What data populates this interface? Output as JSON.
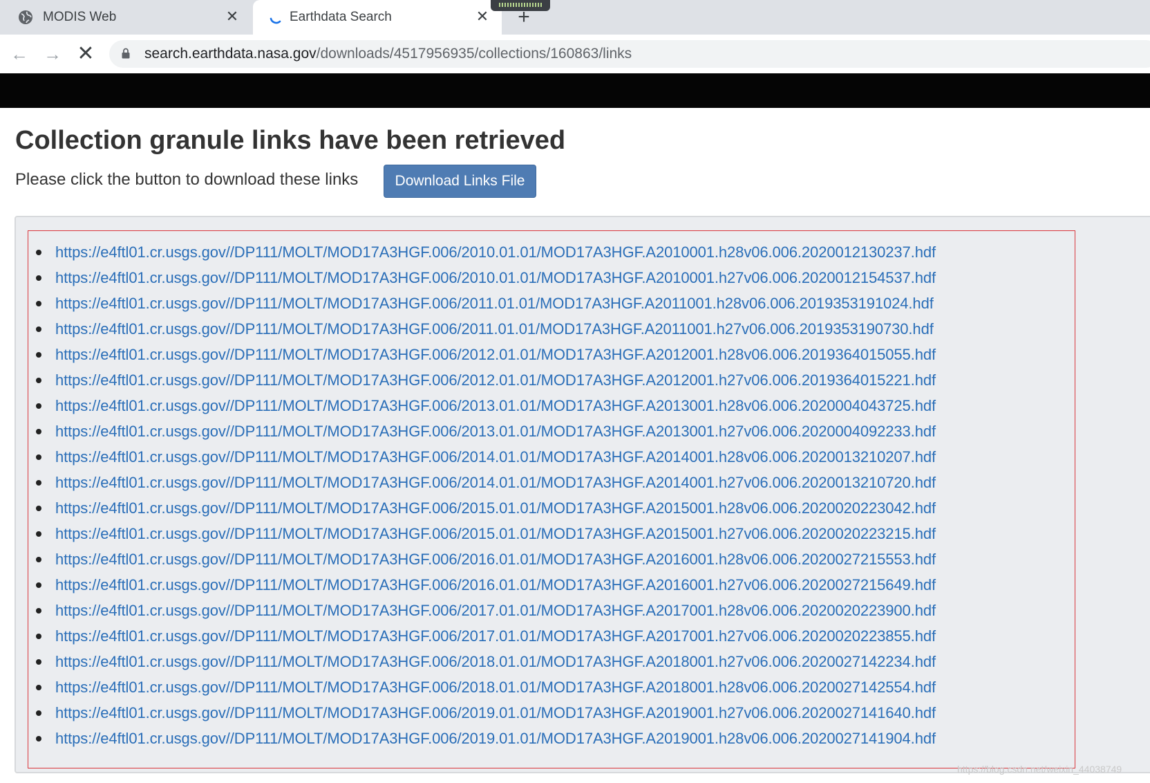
{
  "browser": {
    "tabs": [
      {
        "title": "MODIS Web",
        "active": false
      },
      {
        "title": "Earthdata Search",
        "active": true
      }
    ],
    "address": {
      "host": "search.earthdata.nasa.gov",
      "path": "/downloads/4517956935/collections/160863/links"
    }
  },
  "page": {
    "title": "Collection granule links have been retrieved",
    "instructions": "Please click the button to download these links",
    "download_button": "Download Links File",
    "links": [
      "https://e4ftl01.cr.usgs.gov//DP111/MOLT/MOD17A3HGF.006/2010.01.01/MOD17A3HGF.A2010001.h28v06.006.2020012130237.hdf",
      "https://e4ftl01.cr.usgs.gov//DP111/MOLT/MOD17A3HGF.006/2010.01.01/MOD17A3HGF.A2010001.h27v06.006.2020012154537.hdf",
      "https://e4ftl01.cr.usgs.gov//DP111/MOLT/MOD17A3HGF.006/2011.01.01/MOD17A3HGF.A2011001.h28v06.006.2019353191024.hdf",
      "https://e4ftl01.cr.usgs.gov//DP111/MOLT/MOD17A3HGF.006/2011.01.01/MOD17A3HGF.A2011001.h27v06.006.2019353190730.hdf",
      "https://e4ftl01.cr.usgs.gov//DP111/MOLT/MOD17A3HGF.006/2012.01.01/MOD17A3HGF.A2012001.h28v06.006.2019364015055.hdf",
      "https://e4ftl01.cr.usgs.gov//DP111/MOLT/MOD17A3HGF.006/2012.01.01/MOD17A3HGF.A2012001.h27v06.006.2019364015221.hdf",
      "https://e4ftl01.cr.usgs.gov//DP111/MOLT/MOD17A3HGF.006/2013.01.01/MOD17A3HGF.A2013001.h28v06.006.2020004043725.hdf",
      "https://e4ftl01.cr.usgs.gov//DP111/MOLT/MOD17A3HGF.006/2013.01.01/MOD17A3HGF.A2013001.h27v06.006.2020004092233.hdf",
      "https://e4ftl01.cr.usgs.gov//DP111/MOLT/MOD17A3HGF.006/2014.01.01/MOD17A3HGF.A2014001.h28v06.006.2020013210207.hdf",
      "https://e4ftl01.cr.usgs.gov//DP111/MOLT/MOD17A3HGF.006/2014.01.01/MOD17A3HGF.A2014001.h27v06.006.2020013210720.hdf",
      "https://e4ftl01.cr.usgs.gov//DP111/MOLT/MOD17A3HGF.006/2015.01.01/MOD17A3HGF.A2015001.h28v06.006.2020020223042.hdf",
      "https://e4ftl01.cr.usgs.gov//DP111/MOLT/MOD17A3HGF.006/2015.01.01/MOD17A3HGF.A2015001.h27v06.006.2020020223215.hdf",
      "https://e4ftl01.cr.usgs.gov//DP111/MOLT/MOD17A3HGF.006/2016.01.01/MOD17A3HGF.A2016001.h28v06.006.2020027215553.hdf",
      "https://e4ftl01.cr.usgs.gov//DP111/MOLT/MOD17A3HGF.006/2016.01.01/MOD17A3HGF.A2016001.h27v06.006.2020027215649.hdf",
      "https://e4ftl01.cr.usgs.gov//DP111/MOLT/MOD17A3HGF.006/2017.01.01/MOD17A3HGF.A2017001.h28v06.006.2020020223900.hdf",
      "https://e4ftl01.cr.usgs.gov//DP111/MOLT/MOD17A3HGF.006/2017.01.01/MOD17A3HGF.A2017001.h27v06.006.2020020223855.hdf",
      "https://e4ftl01.cr.usgs.gov//DP111/MOLT/MOD17A3HGF.006/2018.01.01/MOD17A3HGF.A2018001.h27v06.006.2020027142234.hdf",
      "https://e4ftl01.cr.usgs.gov//DP111/MOLT/MOD17A3HGF.006/2018.01.01/MOD17A3HGF.A2018001.h28v06.006.2020027142554.hdf",
      "https://e4ftl01.cr.usgs.gov//DP111/MOLT/MOD17A3HGF.006/2019.01.01/MOD17A3HGF.A2019001.h27v06.006.2020027141640.hdf",
      "https://e4ftl01.cr.usgs.gov//DP111/MOLT/MOD17A3HGF.006/2019.01.01/MOD17A3HGF.A2019001.h28v06.006.2020027141904.hdf"
    ]
  },
  "watermark": "https://blog.csdn.net/weixin_44038749",
  "colors": {
    "link": "#2a6eb8",
    "button": "#4f7cb3",
    "header_bar": "#050505",
    "highlight_border": "#d9353b",
    "panel_bg": "#ebedf0"
  },
  "icons": {
    "tab1_favicon": "globe-icon",
    "tab2_favicon": "loading-spinner-icon",
    "tab_close": "close-icon",
    "new_tab": "plus-icon",
    "back": "arrow-left-icon",
    "forward": "arrow-right-icon",
    "stop": "stop-x-icon",
    "lock": "lock-icon"
  }
}
